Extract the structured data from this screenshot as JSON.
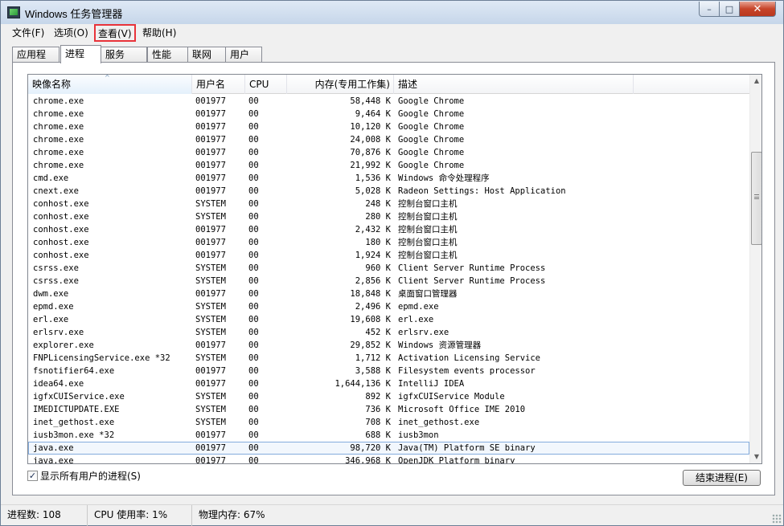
{
  "window": {
    "title": "Windows 任务管理器",
    "buttons": {
      "minimize": "–",
      "maximize": "□",
      "close": "✕"
    }
  },
  "menu": {
    "file": "文件(F)",
    "options": "选项(O)",
    "view": "查看(V)",
    "help": "帮助(H)"
  },
  "tabs": [
    "应用程序",
    "进程",
    "服务",
    "性能",
    "联网",
    "用户"
  ],
  "active_tab": "进程",
  "table": {
    "headers": {
      "name": "映像名称",
      "user": "用户名",
      "cpu": "CPU",
      "memory": "内存(专用工作集)",
      "description": "描述"
    },
    "sorted_column": "name",
    "rows": [
      {
        "name": "chrome.exe",
        "user": "001977",
        "cpu": "00",
        "memory": "58,448 K",
        "description": "Google Chrome"
      },
      {
        "name": "chrome.exe",
        "user": "001977",
        "cpu": "00",
        "memory": "9,464 K",
        "description": "Google Chrome"
      },
      {
        "name": "chrome.exe",
        "user": "001977",
        "cpu": "00",
        "memory": "10,120 K",
        "description": "Google Chrome"
      },
      {
        "name": "chrome.exe",
        "user": "001977",
        "cpu": "00",
        "memory": "24,008 K",
        "description": "Google Chrome"
      },
      {
        "name": "chrome.exe",
        "user": "001977",
        "cpu": "00",
        "memory": "70,876 K",
        "description": "Google Chrome"
      },
      {
        "name": "chrome.exe",
        "user": "001977",
        "cpu": "00",
        "memory": "21,992 K",
        "description": "Google Chrome"
      },
      {
        "name": "cmd.exe",
        "user": "001977",
        "cpu": "00",
        "memory": "1,536 K",
        "description": "Windows 命令处理程序"
      },
      {
        "name": "cnext.exe",
        "user": "001977",
        "cpu": "00",
        "memory": "5,028 K",
        "description": "Radeon Settings: Host Application"
      },
      {
        "name": "conhost.exe",
        "user": "SYSTEM",
        "cpu": "00",
        "memory": "248 K",
        "description": "控制台窗口主机"
      },
      {
        "name": "conhost.exe",
        "user": "SYSTEM",
        "cpu": "00",
        "memory": "280 K",
        "description": "控制台窗口主机"
      },
      {
        "name": "conhost.exe",
        "user": "001977",
        "cpu": "00",
        "memory": "2,432 K",
        "description": "控制台窗口主机"
      },
      {
        "name": "conhost.exe",
        "user": "001977",
        "cpu": "00",
        "memory": "180 K",
        "description": "控制台窗口主机"
      },
      {
        "name": "conhost.exe",
        "user": "001977",
        "cpu": "00",
        "memory": "1,924 K",
        "description": "控制台窗口主机"
      },
      {
        "name": "csrss.exe",
        "user": "SYSTEM",
        "cpu": "00",
        "memory": "960 K",
        "description": "Client Server Runtime Process"
      },
      {
        "name": "csrss.exe",
        "user": "SYSTEM",
        "cpu": "00",
        "memory": "2,856 K",
        "description": "Client Server Runtime Process"
      },
      {
        "name": "dwm.exe",
        "user": "001977",
        "cpu": "00",
        "memory": "18,848 K",
        "description": "桌面窗口管理器"
      },
      {
        "name": "epmd.exe",
        "user": "SYSTEM",
        "cpu": "00",
        "memory": "2,496 K",
        "description": "epmd.exe"
      },
      {
        "name": "erl.exe",
        "user": "SYSTEM",
        "cpu": "00",
        "memory": "19,608 K",
        "description": "erl.exe"
      },
      {
        "name": "erlsrv.exe",
        "user": "SYSTEM",
        "cpu": "00",
        "memory": "452 K",
        "description": "erlsrv.exe"
      },
      {
        "name": "explorer.exe",
        "user": "001977",
        "cpu": "00",
        "memory": "29,852 K",
        "description": "Windows 资源管理器"
      },
      {
        "name": "FNPLicensingService.exe *32",
        "user": "SYSTEM",
        "cpu": "00",
        "memory": "1,712 K",
        "description": "Activation Licensing Service"
      },
      {
        "name": "fsnotifier64.exe",
        "user": "001977",
        "cpu": "00",
        "memory": "3,588 K",
        "description": "Filesystem events processor"
      },
      {
        "name": "idea64.exe",
        "user": "001977",
        "cpu": "00",
        "memory": "1,644,136 K",
        "description": "IntelliJ IDEA"
      },
      {
        "name": "igfxCUIService.exe",
        "user": "SYSTEM",
        "cpu": "00",
        "memory": "892 K",
        "description": "igfxCUIService Module"
      },
      {
        "name": "IMEDICTUPDATE.EXE",
        "user": "SYSTEM",
        "cpu": "00",
        "memory": "736 K",
        "description": "Microsoft Office IME 2010"
      },
      {
        "name": "inet_gethost.exe",
        "user": "SYSTEM",
        "cpu": "00",
        "memory": "708 K",
        "description": "inet_gethost.exe"
      },
      {
        "name": "iusb3mon.exe *32",
        "user": "001977",
        "cpu": "00",
        "memory": "688 K",
        "description": "iusb3mon"
      },
      {
        "name": "java.exe",
        "user": "001977",
        "cpu": "00",
        "memory": "98,720 K",
        "description": "Java(TM) Platform SE binary",
        "selected": true
      },
      {
        "name": "java.exe",
        "user": "001977",
        "cpu": "00",
        "memory": "346,968 K",
        "description": "OpenJDK Platform binary"
      }
    ]
  },
  "bottom": {
    "show_all_label": "显示所有用户的进程(S)",
    "show_all_checked": true,
    "check_mark": "✓",
    "end_process_label": "结束进程(E)"
  },
  "status": {
    "processes": "进程数: 108",
    "cpu": "CPU 使用率: 1%",
    "memory": "物理内存: 67%"
  },
  "scrollbar": {
    "up": "▲",
    "down": "▼"
  },
  "sort_indicator": "^"
}
